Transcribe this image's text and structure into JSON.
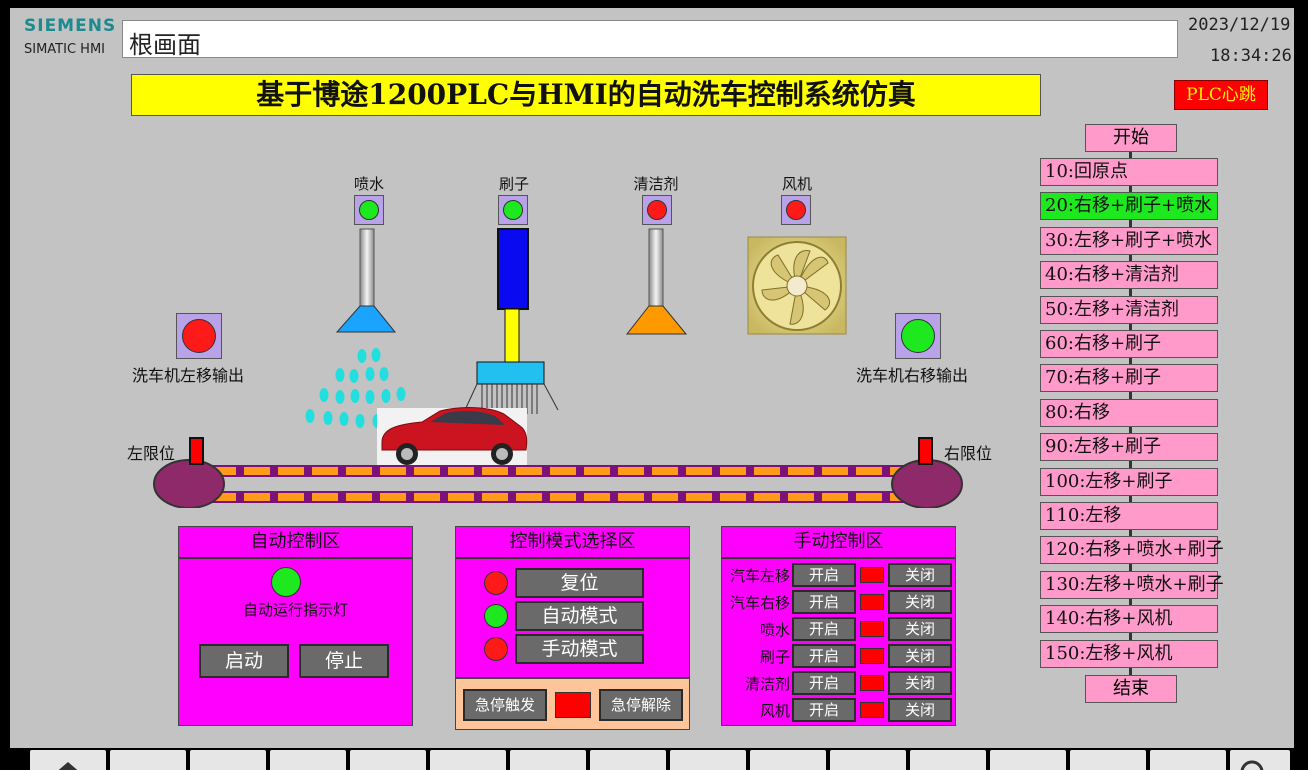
{
  "header": {
    "brand": "SIEMENS",
    "product": "SIMATIC HMI",
    "screen_name": "根画面",
    "date": "2023/12/19",
    "time": "18:34:26"
  },
  "title": "基于博途1200PLC与HMI的自动洗车控制系统仿真",
  "heartbeat_label": "PLC心跳",
  "devices": {
    "water": {
      "label": "喷水",
      "state": "on"
    },
    "brush": {
      "label": "刷子",
      "state": "on"
    },
    "cleaner": {
      "label": "清洁剂",
      "state": "off"
    },
    "fan": {
      "label": "风机",
      "state": "off"
    }
  },
  "outputs": {
    "left_move": {
      "label": "洗车机左移输出",
      "state": "off"
    },
    "right_move": {
      "label": "洗车机右移输出",
      "state": "on"
    }
  },
  "limits": {
    "left": "左限位",
    "right": "右限位"
  },
  "sequence": {
    "start": "开始",
    "end": "结束",
    "steps": [
      {
        "label": "10:回原点",
        "active": false
      },
      {
        "label": "20:右移+刷子+喷水",
        "active": true
      },
      {
        "label": "30:左移+刷子+喷水",
        "active": false
      },
      {
        "label": "40:右移+清洁剂",
        "active": false
      },
      {
        "label": "50:左移+清洁剂",
        "active": false
      },
      {
        "label": "60:右移+刷子",
        "active": false
      },
      {
        "label": "70:右移+刷子",
        "active": false
      },
      {
        "label": "80:右移",
        "active": false
      },
      {
        "label": "90:左移+刷子",
        "active": false
      },
      {
        "label": "100:左移+刷子",
        "active": false
      },
      {
        "label": "110:左移",
        "active": false
      },
      {
        "label": "120:右移+喷水+刷子",
        "active": false
      },
      {
        "label": "130:左移+喷水+刷子",
        "active": false
      },
      {
        "label": "140:右移+风机",
        "active": false
      },
      {
        "label": "150:左移+风机",
        "active": false
      }
    ]
  },
  "auto_panel": {
    "title": "自动控制区",
    "indicator_label": "自动运行指示灯",
    "indicator_state": "on",
    "start_label": "启动",
    "stop_label": "停止"
  },
  "mode_panel": {
    "title": "控制模式选择区",
    "modes": [
      {
        "label": "复位",
        "state": "off"
      },
      {
        "label": "自动模式",
        "state": "on"
      },
      {
        "label": "手动模式",
        "state": "off"
      }
    ],
    "estop_trigger": "急停触发",
    "estop_release": "急停解除"
  },
  "manual_panel": {
    "title": "手动控制区",
    "on_label": "开启",
    "off_label": "关闭",
    "rows": [
      "汽车左移",
      "汽车右移",
      "喷水",
      "刷子",
      "清洁剂",
      "风机"
    ]
  },
  "colors": {
    "title_bg": "#ffff00",
    "panel_bg": "#ff00ff",
    "step_bg": "#ff9acb",
    "active_step": "#1ee81e",
    "lamp_on": "#1ee81e",
    "lamp_off": "#ff1a1a"
  }
}
